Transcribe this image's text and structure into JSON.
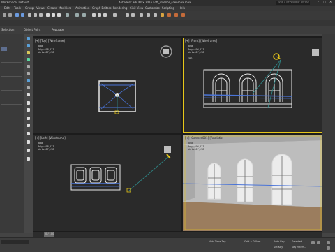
{
  "app": {
    "workspace": "Workspace: Default",
    "title": "Autodesk 3ds Max 2016    Loft_interior_scenmax.max",
    "search_placeholder": "Type a keyword or phrase"
  },
  "menu": [
    "Edit",
    "Tools",
    "Group",
    "Views",
    "Create",
    "Modifiers",
    "Animation",
    "Graph Editors",
    "Rendering",
    "Civil View",
    "Customize",
    "Scripting",
    "Help"
  ],
  "subbar": {
    "selection": "Selection",
    "object_paint": "Object Paint",
    "populate": "Populate"
  },
  "viewports": [
    {
      "label": "[+] [Top] [Wireframe]",
      "stats": {
        "total": "Total",
        "polys_label": "Polys:",
        "polys": "98,673",
        "verts_label": "Verts:",
        "verts": "67,178"
      }
    },
    {
      "label": "[+] [Front] [Wireframe]",
      "stats": {
        "total": "Total",
        "polys_label": "Polys:",
        "polys": "98,673",
        "verts_label": "Verts:",
        "verts": "67,178",
        "fps_label": "FPS:"
      }
    },
    {
      "label": "[+] [Left] [Wireframe]",
      "stats": {
        "total": "Total",
        "polys_label": "Polys:",
        "polys": "98,673",
        "verts_label": "Verts:",
        "verts": "67,178"
      }
    },
    {
      "label": "[+] [Camera001] [Realistic]",
      "stats": {
        "total": "Total",
        "polys_label": "Polys:",
        "polys": "98,673",
        "verts_label": "Verts:",
        "verts": "67,178"
      }
    }
  ],
  "timeline": {
    "frame": "0 / 100"
  },
  "status": {
    "addtime": "Add Time Tag",
    "grid": "Grid = 0.0cm",
    "autokey": "Auto Key",
    "selected": "Selected",
    "setkey": "Set Key",
    "keyfilters": "Key Filters..."
  },
  "colors": {
    "active_border": "#e6c619",
    "wire_white": "#e8e8e8",
    "wire_blue": "#4a74d8",
    "floor": "#9b7d5e",
    "wall": "#bdbdbd"
  }
}
